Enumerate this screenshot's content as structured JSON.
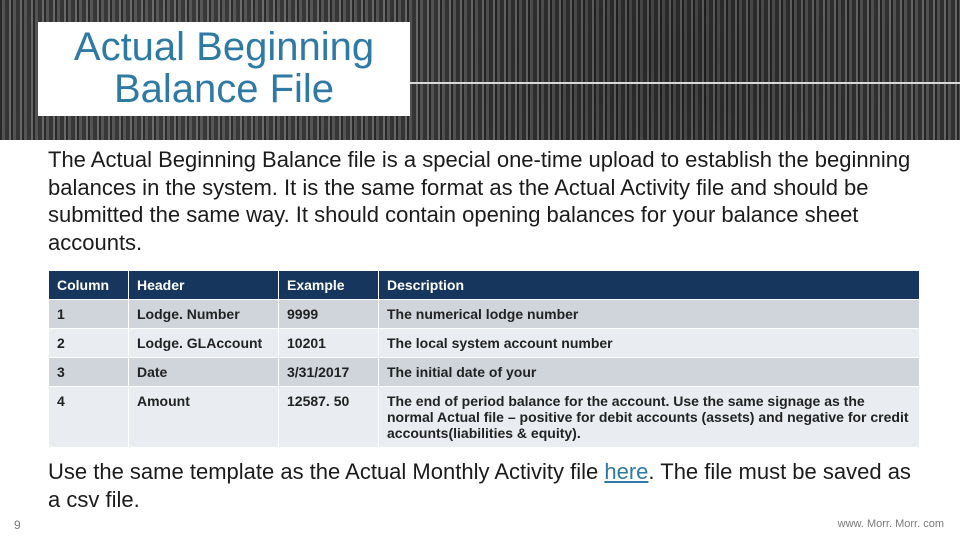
{
  "title": "Actual Beginning Balance File",
  "intro": "The Actual Beginning Balance file is a special one-time upload to establish the beginning balances in the system. It is the same format as the Actual Activity file and should be submitted the same way. It should contain opening balances for your balance sheet accounts.",
  "table": {
    "headers": [
      "Column",
      "Header",
      "Example",
      "Description"
    ],
    "rows": [
      {
        "col": "1",
        "header": "Lodge. Number",
        "example": "9999",
        "desc": "The numerical lodge number"
      },
      {
        "col": "2",
        "header": "Lodge. GLAccount",
        "example": "10201",
        "desc": "The local system account number"
      },
      {
        "col": "3",
        "header": "Date",
        "example": "3/31/2017",
        "desc": "The initial date of your"
      },
      {
        "col": "4",
        "header": "Amount",
        "example": "12587. 50",
        "desc": "The end of period balance for the account. Use the same signage as the normal Actual file – positive for debit accounts (assets) and negative for credit accounts(liabilities & equity)."
      }
    ]
  },
  "outro_pre": "Use the same template as the Actual Monthly Activity file ",
  "outro_link": "here",
  "outro_post": ". The file must be saved as a csv file.",
  "page_number": "9",
  "footer_url": "www. Morr. Morr. com"
}
